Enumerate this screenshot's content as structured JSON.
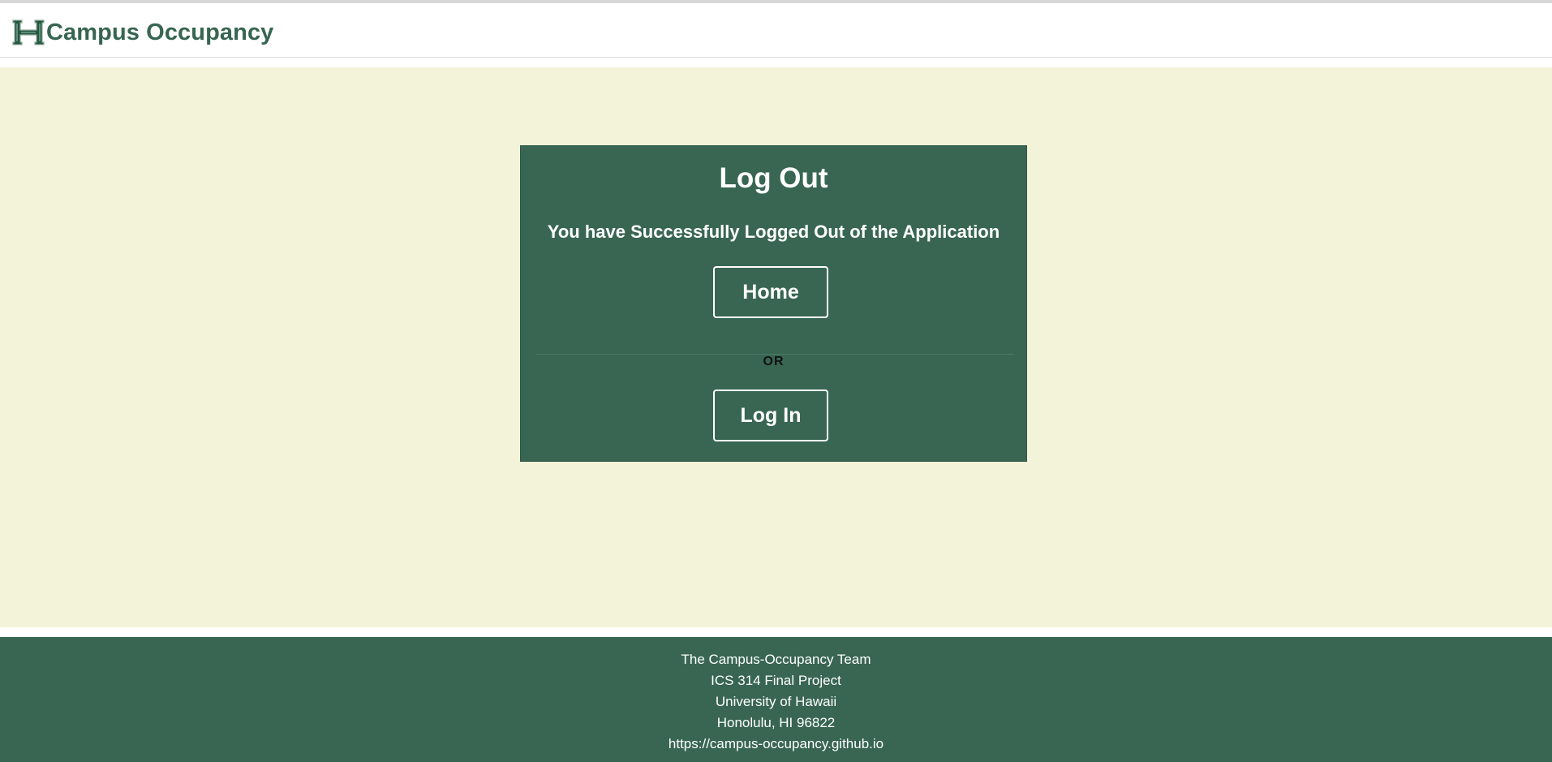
{
  "navbar": {
    "brand_text": "Campus Occupancy",
    "logo_icon": "uh-h-logo-icon",
    "brand_color": "#376551"
  },
  "main": {
    "background": "#f3f3da",
    "card": {
      "title": "Log Out",
      "subtitle": "You have Successfully Logged Out of the Application",
      "home_label": "Home",
      "divider_label": "OR",
      "login_label": "Log In",
      "card_color": "#386653"
    }
  },
  "footer": {
    "lines": [
      "The Campus-Occupancy Team",
      "ICS 314 Final Project",
      "University of Hawaii",
      "Honolulu, HI 96822",
      "https://campus-occupancy.github.io"
    ],
    "background": "#386653"
  }
}
